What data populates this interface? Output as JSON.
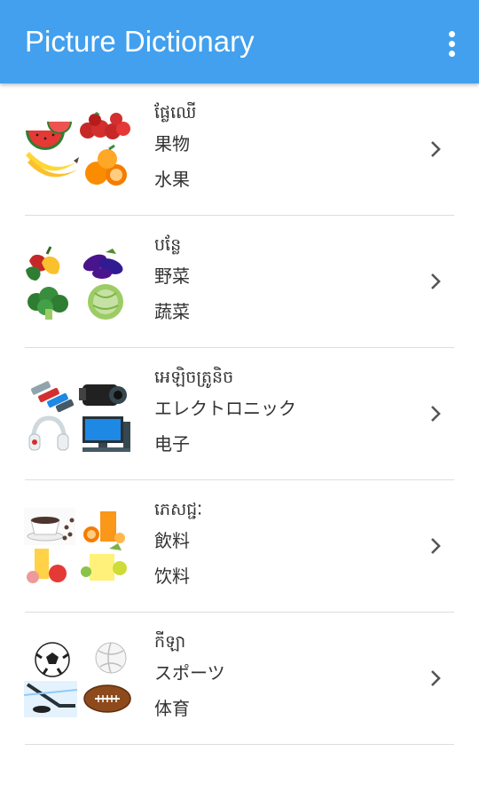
{
  "app_bar": {
    "title": "Picture Dictionary",
    "color": "#42a0ee",
    "overflow_icon": "more-vertical-icon"
  },
  "categories": [
    {
      "khmer": "ផ្លែឈើ",
      "japanese": "果物",
      "chinese": "水果",
      "thumbnail_icon": "fruits-image",
      "chevron_icon": "chevron-right-icon"
    },
    {
      "khmer": "បន្លែ",
      "japanese": "野菜",
      "chinese": "蔬菜",
      "thumbnail_icon": "vegetables-image",
      "chevron_icon": "chevron-right-icon"
    },
    {
      "khmer": "អេឡិចត្រូនិច",
      "japanese": "エレクトロニック",
      "chinese": "电子",
      "thumbnail_icon": "electronics-image",
      "chevron_icon": "chevron-right-icon"
    },
    {
      "khmer": "ភេសជ្ជៈ",
      "japanese": "飲料",
      "chinese": "饮料",
      "thumbnail_icon": "beverages-image",
      "chevron_icon": "chevron-right-icon"
    },
    {
      "khmer": "កីឡា",
      "japanese": "スポーツ",
      "chinese": "体育",
      "thumbnail_icon": "sports-image",
      "chevron_icon": "chevron-right-icon"
    }
  ]
}
